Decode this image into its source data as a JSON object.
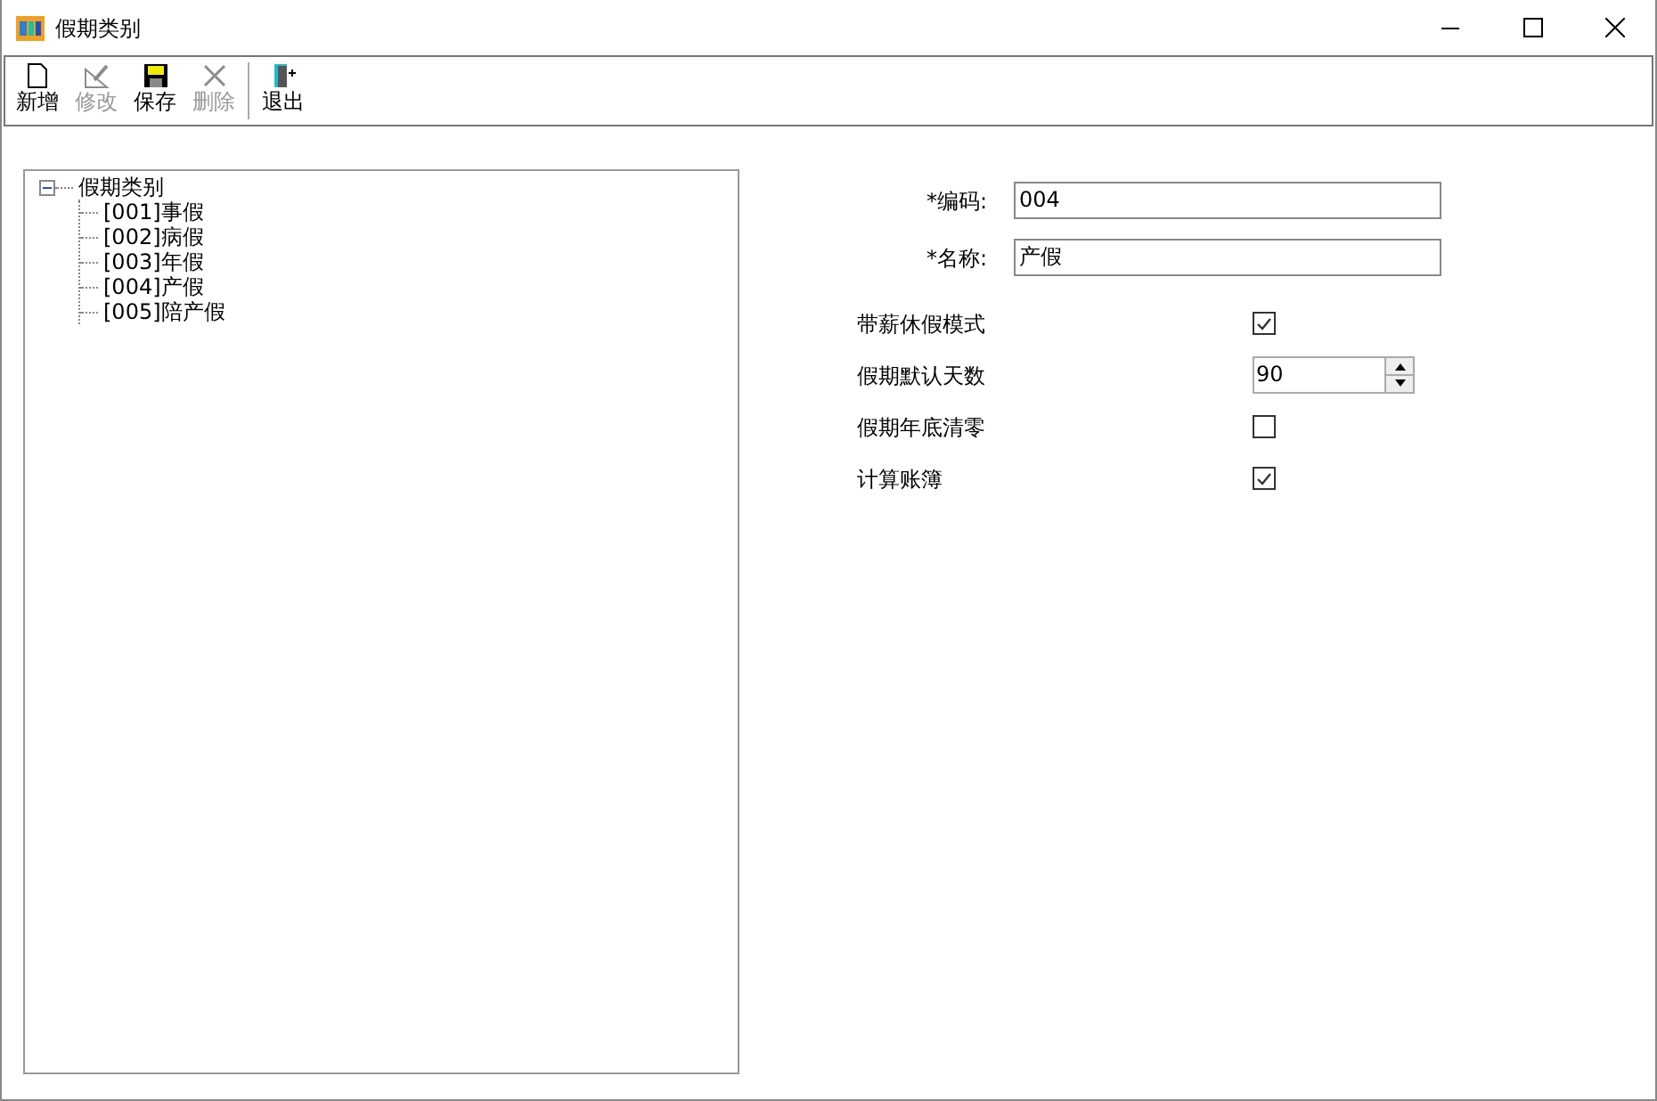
{
  "window": {
    "title": "假期类别"
  },
  "toolbar": [
    {
      "label": "新增",
      "kind": "new",
      "disabled": false
    },
    {
      "label": "修改",
      "kind": "edit",
      "disabled": true
    },
    {
      "label": "保存",
      "kind": "save",
      "disabled": false
    },
    {
      "label": "删除",
      "kind": "delete",
      "disabled": true
    },
    {
      "label": "退出",
      "kind": "exit",
      "disabled": false
    }
  ],
  "tree": {
    "label": "假期类别",
    "expanded": true,
    "children": [
      {
        "label": "[001]事假"
      },
      {
        "label": "[002]病假"
      },
      {
        "label": "[003]年假"
      },
      {
        "label": "[004]产假"
      },
      {
        "label": "[005]陪产假"
      }
    ]
  },
  "form": {
    "fields": [
      {
        "label": "*编码:",
        "value": "004"
      },
      {
        "label": "*名称:",
        "value": "产假"
      }
    ],
    "options": [
      {
        "label": "带薪休假模式",
        "kind": "checkbox",
        "checked": true
      },
      {
        "label": "假期默认天数",
        "kind": "spinner",
        "value": "90"
      },
      {
        "label": "假期年底清零",
        "kind": "checkbox",
        "checked": false
      },
      {
        "label": "计算账簿",
        "kind": "checkbox",
        "checked": true
      }
    ]
  }
}
